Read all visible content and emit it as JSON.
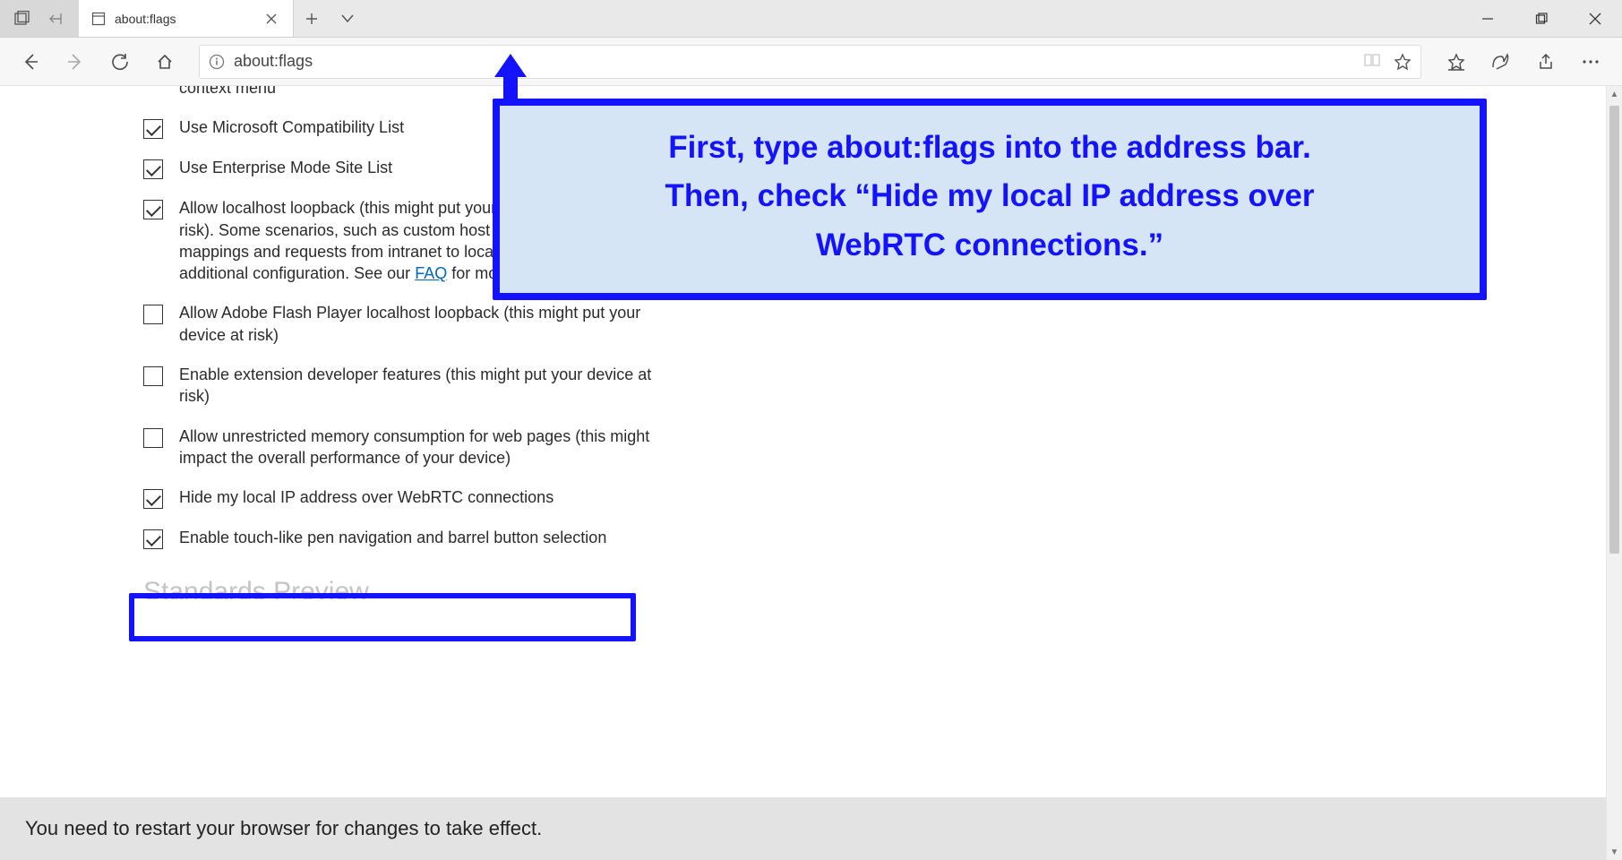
{
  "tab": {
    "title": "about:flags"
  },
  "address": {
    "url": "about:flags"
  },
  "settings": [
    {
      "id": "context-menu-partial",
      "checked": true,
      "text": "context menu",
      "partial_top": true
    },
    {
      "id": "compat-list",
      "checked": true,
      "text": "Use Microsoft Compatibility List"
    },
    {
      "id": "enterprise-mode",
      "checked": true,
      "text": "Use Enterprise Mode Site List"
    },
    {
      "id": "localhost-loopback",
      "checked": true,
      "text_pre": "Allow localhost loopback (this might put your device at a security risk). Some scenarios, such as custom host names, custom file mappings and requests from intranet to localhost may require additional configuration. See our ",
      "link": "FAQ",
      "text_post": " for more information."
    },
    {
      "id": "flash-loopback",
      "checked": false,
      "text": "Allow Adobe Flash Player localhost loopback (this might put your device at risk)"
    },
    {
      "id": "ext-dev",
      "checked": false,
      "text": "Enable extension developer features (this might put your device at risk)"
    },
    {
      "id": "memory",
      "checked": false,
      "text": "Allow unrestricted memory consumption for web pages (this might impact the overall performance of your device)"
    },
    {
      "id": "hide-ip",
      "checked": true,
      "text": "Hide my local IP address over WebRTC connections"
    },
    {
      "id": "pen-nav",
      "checked": true,
      "text": "Enable touch-like pen navigation and barrel button selection"
    }
  ],
  "section_heading": "Standards Preview",
  "callout": {
    "line1": "First, type about:flags into the address bar.",
    "line2": "Then, check “Hide my local IP address over",
    "line3": "WebRTC connections.”"
  },
  "banner": "You need to restart your browser for changes to take effect."
}
